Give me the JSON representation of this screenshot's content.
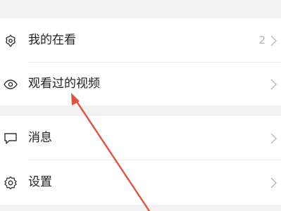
{
  "sections": [
    {
      "items": [
        {
          "label": "我的在看",
          "badge": "2",
          "icon": "sparkle-icon"
        },
        {
          "label": "观看过的视频",
          "icon": "eye-icon"
        }
      ]
    },
    {
      "items": [
        {
          "label": "消息",
          "icon": "message-icon"
        },
        {
          "label": "设置",
          "icon": "gear-icon"
        }
      ]
    }
  ],
  "colors": {
    "background": "#f2f2f2",
    "card": "#ffffff",
    "text": "#222222",
    "secondary_text": "#b3b3b3",
    "annotation_arrow": "#e0533f"
  }
}
